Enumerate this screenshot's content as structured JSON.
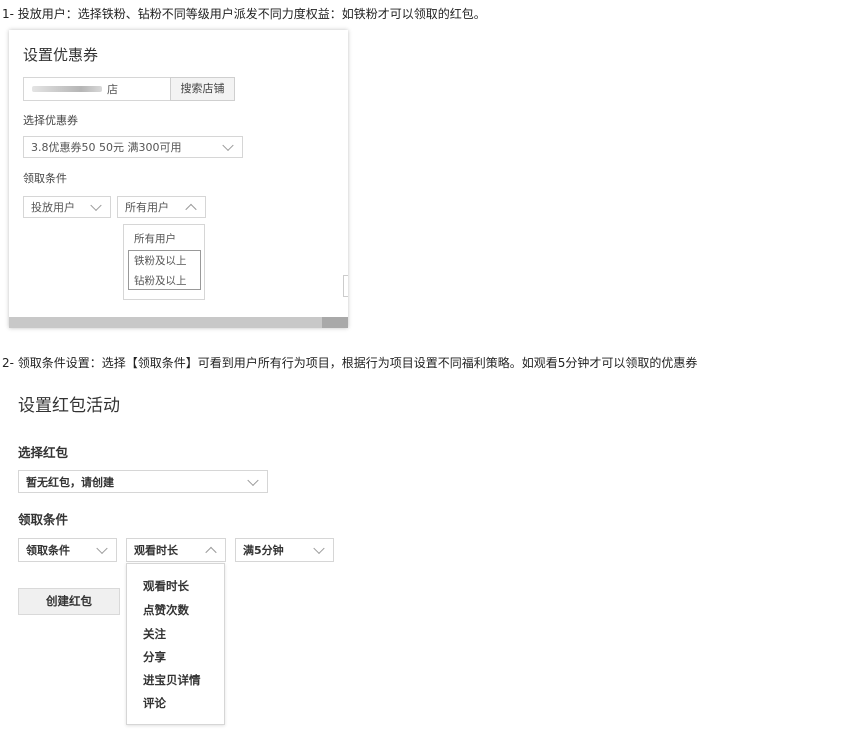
{
  "step1": {
    "text": "1- 投放用户：选择铁粉、钻粉不同等级用户派发不同力度权益：如铁粉才可以领取的红包。",
    "panel": {
      "title": "设置优惠券",
      "store_input_value": "店",
      "search_button": "搜索店铺",
      "coupon_label": "选择优惠券",
      "coupon_selected": "3.8优惠券50 50元 满300可用",
      "condition_label": "领取条件",
      "condition_type": "投放用户",
      "user_select": "所有用户",
      "user_options": [
        "所有用户",
        "铁粉及以上",
        "钻粉及以上"
      ]
    }
  },
  "step2": {
    "text": "2- 领取条件设置：选择【领取条件】可看到用户所有行为项目，根据行为项目设置不同福利策略。如观看5分钟才可以领取的优惠券",
    "panel": {
      "title": "设置红包活动",
      "redpacket_label": "选择红包",
      "redpacket_selected": "暂无红包，请创建",
      "condition_label": "领取条件",
      "condition_select": "领取条件",
      "behavior_select": "观看时长",
      "value_select": "满5分钟",
      "create_button": "创建红包",
      "behavior_options": [
        "观看时长",
        "点赞次数",
        "关注",
        "分享",
        "进宝贝详情",
        "评论"
      ]
    }
  }
}
